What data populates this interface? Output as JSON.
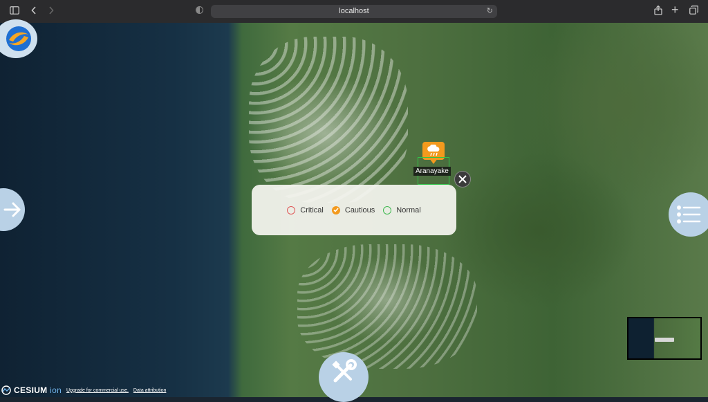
{
  "browser": {
    "url": "localhost"
  },
  "map": {
    "marker": {
      "label": "Aranayake",
      "color": "#f39a1e"
    },
    "legend": {
      "items": [
        {
          "label": "Critical",
          "color": "#e05757",
          "checked": false
        },
        {
          "label": "Cautious",
          "color": "#f39a1e",
          "checked": true
        },
        {
          "label": "Normal",
          "color": "#3fb950",
          "checked": false
        }
      ]
    },
    "attribution": {
      "brand": "CESIUM",
      "brand_suffix": "ion",
      "upgrade_link": "Upgrade for commercial use.",
      "data_link": "Data attribution"
    }
  },
  "icons": {
    "logo": "app-logo-icon",
    "next": "arrow-right-icon",
    "menu": "list-menu-icon",
    "tools": "tools-icon",
    "close": "close-icon",
    "marker": "landslide-warning-icon"
  }
}
